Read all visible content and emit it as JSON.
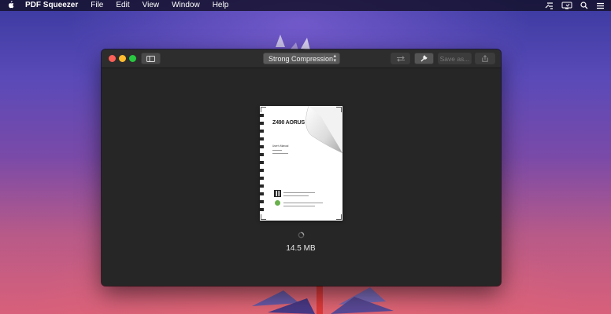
{
  "menubar": {
    "app_name": "PDF Squeezer",
    "items": [
      "File",
      "Edit",
      "View",
      "Window",
      "Help"
    ],
    "status_icons": [
      "script-icon",
      "display-icon",
      "search-icon",
      "list-icon"
    ]
  },
  "toolbar": {
    "compression_preset": "Strong Compression",
    "save_label": "Save as..."
  },
  "document": {
    "thumbnail_title": "Z490 AORUS M",
    "thumbnail_subtitle": "User's Manual",
    "file_size": "14.5 MB"
  },
  "colors": {
    "close": "#fe5f57",
    "minimize": "#febc2e",
    "zoom": "#28c840",
    "window_bg": "#262626"
  }
}
